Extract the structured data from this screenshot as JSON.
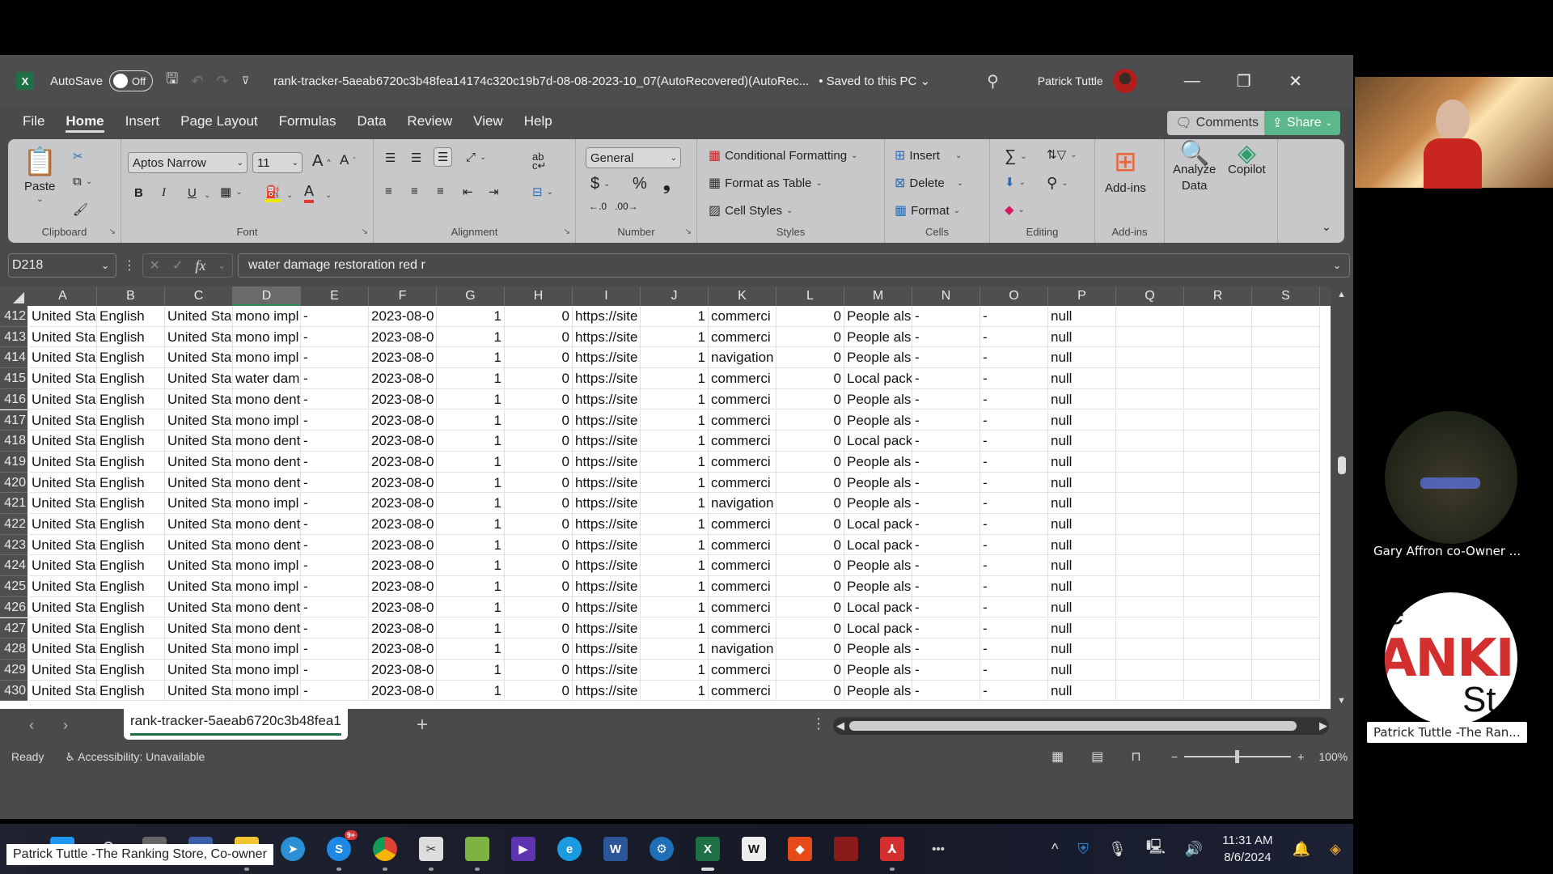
{
  "titlebar": {
    "app_icon": "excel-icon",
    "autosave_label": "AutoSave",
    "autosave_state": "Off",
    "doc_title": "rank-tracker-5aeab6720c3b48fea14174c320c19b7d-08-08-2023-10_07(AutoRecovered)(AutoRec...",
    "save_status": "• Saved to this PC",
    "user_name": "Patrick Tuttle"
  },
  "menu": {
    "tabs": [
      "File",
      "Home",
      "Insert",
      "Page Layout",
      "Formulas",
      "Data",
      "Review",
      "View",
      "Help"
    ],
    "active": "Home",
    "comments_label": "Comments",
    "share_label": "Share"
  },
  "ribbon": {
    "clipboard": {
      "paste_label": "Paste",
      "group_label": "Clipboard"
    },
    "font": {
      "font_name": "Aptos Narrow",
      "font_size": "11",
      "group_label": "Font",
      "bold": "B",
      "italic": "I",
      "underline": "U",
      "grow": "A^",
      "shrink": "Aˇ",
      "font_color_letter": "A"
    },
    "alignment": {
      "group_label": "Alignment"
    },
    "number": {
      "format": "General",
      "currency": "$",
      "percent": "%",
      "comma": "❟",
      "group_label": "Number"
    },
    "styles": {
      "conditional": "Conditional Formatting",
      "format_table": "Format as Table",
      "cell_styles": "Cell Styles",
      "group_label": "Styles"
    },
    "cells": {
      "insert": "Insert",
      "delete": "Delete",
      "format": "Format",
      "group_label": "Cells"
    },
    "editing": {
      "group_label": "Editing"
    },
    "addins": {
      "addins_label": "Add-ins",
      "group_label": "Add-ins",
      "analyze_line1": "Analyze",
      "analyze_line2": "Data",
      "copilot_label": "Copilot"
    }
  },
  "formula_bar": {
    "name_box": "D218",
    "formula": "water damage restoration red r"
  },
  "sheet": {
    "columns": [
      "A",
      "B",
      "C",
      "D",
      "E",
      "F",
      "G",
      "H",
      "I",
      "J",
      "K",
      "L",
      "M",
      "N",
      "O",
      "P",
      "Q",
      "R",
      "S"
    ],
    "selected_column": "D",
    "rows": [
      {
        "n": "412",
        "A": "United Sta",
        "B": "English",
        "C": "United Sta",
        "D": "mono impl",
        "E": "-",
        "F": "2023-08-0",
        "G": "1",
        "H": "0",
        "I": "https://site",
        "J": "1",
        "K": "commerci",
        "L": "0",
        "M": "People als",
        "N": "-",
        "O": "-",
        "P": "null"
      },
      {
        "n": "413",
        "A": "United Sta",
        "B": "English",
        "C": "United Sta",
        "D": "mono impl",
        "E": "-",
        "F": "2023-08-0",
        "G": "1",
        "H": "0",
        "I": "https://site",
        "J": "1",
        "K": "commerci",
        "L": "0",
        "M": "People als",
        "N": "-",
        "O": "-",
        "P": "null"
      },
      {
        "n": "414",
        "A": "United Sta",
        "B": "English",
        "C": "United Sta",
        "D": "mono impl",
        "E": "-",
        "F": "2023-08-0",
        "G": "1",
        "H": "0",
        "I": "https://site",
        "J": "1",
        "K": "navigation",
        "L": "0",
        "M": "People als",
        "N": "-",
        "O": "-",
        "P": "null"
      },
      {
        "n": "415",
        "A": "United Sta",
        "B": "English",
        "C": "United Sta",
        "D": "water dam",
        "E": "-",
        "F": "2023-08-0",
        "G": "1",
        "H": "0",
        "I": "https://site",
        "J": "1",
        "K": "commerci",
        "L": "0",
        "M": "Local pack",
        "N": "-",
        "O": "-",
        "P": "null"
      },
      {
        "n": "416",
        "A": "United Sta",
        "B": "English",
        "C": "United Sta",
        "D": "mono dent",
        "E": "-",
        "F": "2023-08-0",
        "G": "1",
        "H": "0",
        "I": "https://site",
        "J": "1",
        "K": "commerci",
        "L": "0",
        "M": "People als",
        "N": "-",
        "O": "-",
        "P": "null"
      },
      {
        "n": "417",
        "A": "United Sta",
        "B": "English",
        "C": "United Sta",
        "D": "mono impl",
        "E": "-",
        "F": "2023-08-0",
        "G": "1",
        "H": "0",
        "I": "https://site",
        "J": "1",
        "K": "commerci",
        "L": "0",
        "M": "People als",
        "N": "-",
        "O": "-",
        "P": "null"
      },
      {
        "n": "418",
        "A": "United Sta",
        "B": "English",
        "C": "United Sta",
        "D": "mono dent",
        "E": "-",
        "F": "2023-08-0",
        "G": "1",
        "H": "0",
        "I": "https://site",
        "J": "1",
        "K": "commerci",
        "L": "0",
        "M": "Local pack",
        "N": "-",
        "O": "-",
        "P": "null"
      },
      {
        "n": "419",
        "A": "United Sta",
        "B": "English",
        "C": "United Sta",
        "D": "mono dent",
        "E": "-",
        "F": "2023-08-0",
        "G": "1",
        "H": "0",
        "I": "https://site",
        "J": "1",
        "K": "commerci",
        "L": "0",
        "M": "People als",
        "N": "-",
        "O": "-",
        "P": "null"
      },
      {
        "n": "420",
        "A": "United Sta",
        "B": "English",
        "C": "United Sta",
        "D": "mono dent",
        "E": "-",
        "F": "2023-08-0",
        "G": "1",
        "H": "0",
        "I": "https://site",
        "J": "1",
        "K": "commerci",
        "L": "0",
        "M": "People als",
        "N": "-",
        "O": "-",
        "P": "null"
      },
      {
        "n": "421",
        "A": "United Sta",
        "B": "English",
        "C": "United Sta",
        "D": "mono impl",
        "E": "-",
        "F": "2023-08-0",
        "G": "1",
        "H": "0",
        "I": "https://site",
        "J": "1",
        "K": "navigation",
        "L": "0",
        "M": "People als",
        "N": "-",
        "O": "-",
        "P": "null"
      },
      {
        "n": "422",
        "A": "United Sta",
        "B": "English",
        "C": "United Sta",
        "D": "mono dent",
        "E": "-",
        "F": "2023-08-0",
        "G": "1",
        "H": "0",
        "I": "https://site",
        "J": "1",
        "K": "commerci",
        "L": "0",
        "M": "Local pack",
        "N": "-",
        "O": "-",
        "P": "null"
      },
      {
        "n": "423",
        "A": "United Sta",
        "B": "English",
        "C": "United Sta",
        "D": "mono dent",
        "E": "-",
        "F": "2023-08-0",
        "G": "1",
        "H": "0",
        "I": "https://site",
        "J": "1",
        "K": "commerci",
        "L": "0",
        "M": "Local pack",
        "N": "-",
        "O": "-",
        "P": "null"
      },
      {
        "n": "424",
        "A": "United Sta",
        "B": "English",
        "C": "United Sta",
        "D": "mono impl",
        "E": "-",
        "F": "2023-08-0",
        "G": "1",
        "H": "0",
        "I": "https://site",
        "J": "1",
        "K": "commerci",
        "L": "0",
        "M": "People als",
        "N": "-",
        "O": "-",
        "P": "null"
      },
      {
        "n": "425",
        "A": "United Sta",
        "B": "English",
        "C": "United Sta",
        "D": "mono impl",
        "E": "-",
        "F": "2023-08-0",
        "G": "1",
        "H": "0",
        "I": "https://site",
        "J": "1",
        "K": "commerci",
        "L": "0",
        "M": "People als",
        "N": "-",
        "O": "-",
        "P": "null"
      },
      {
        "n": "426",
        "A": "United Sta",
        "B": "English",
        "C": "United Sta",
        "D": "mono dent",
        "E": "-",
        "F": "2023-08-0",
        "G": "1",
        "H": "0",
        "I": "https://site",
        "J": "1",
        "K": "commerci",
        "L": "0",
        "M": "Local pack",
        "N": "-",
        "O": "-",
        "P": "null"
      },
      {
        "n": "427",
        "A": "United Sta",
        "B": "English",
        "C": "United Sta",
        "D": "mono dent",
        "E": "-",
        "F": "2023-08-0",
        "G": "1",
        "H": "0",
        "I": "https://site",
        "J": "1",
        "K": "commerci",
        "L": "0",
        "M": "Local pack",
        "N": "-",
        "O": "-",
        "P": "null"
      },
      {
        "n": "428",
        "A": "United Sta",
        "B": "English",
        "C": "United Sta",
        "D": "mono impl",
        "E": "-",
        "F": "2023-08-0",
        "G": "1",
        "H": "0",
        "I": "https://site",
        "J": "1",
        "K": "navigation",
        "L": "0",
        "M": "People als",
        "N": "-",
        "O": "-",
        "P": "null"
      },
      {
        "n": "429",
        "A": "United Sta",
        "B": "English",
        "C": "United Sta",
        "D": "mono impl",
        "E": "-",
        "F": "2023-08-0",
        "G": "1",
        "H": "0",
        "I": "https://site",
        "J": "1",
        "K": "commerci",
        "L": "0",
        "M": "People als",
        "N": "-",
        "O": "-",
        "P": "null"
      },
      {
        "n": "430",
        "A": "United Sta",
        "B": "English",
        "C": "United Sta",
        "D": "mono impl",
        "E": "-",
        "F": "2023-08-0",
        "G": "1",
        "H": "0",
        "I": "https://site",
        "J": "1",
        "K": "commerci",
        "L": "0",
        "M": "People als",
        "N": "-",
        "O": "-",
        "P": "null"
      }
    ],
    "numeric_columns": [
      "G",
      "H",
      "J",
      "L"
    ],
    "tab_name": "rank-tracker-5aeab6720c3b48fea1"
  },
  "statusbar": {
    "ready": "Ready",
    "accessibility": "Accessibility: Unavailable",
    "zoom": "100%",
    "zoom_fraction": 0.5
  },
  "taskbar": {
    "apps": [
      "start",
      "search",
      "task-view",
      "remote-desktop",
      "file-explorer",
      "telegram",
      "skype",
      "chrome",
      "snipping-tool",
      "notepad",
      "clipchamp",
      "edge",
      "word",
      "app-tool",
      "excel",
      "wordpad",
      "anydesk",
      "app-red",
      "acrobat",
      "more"
    ],
    "skype_badge": "9+",
    "time": "11:31 AM",
    "date": "8/6/2024"
  },
  "meeting": {
    "participant_1": "Gary Affron co-Owner ...",
    "participant_2": "Patrick Tuttle -The Ran...",
    "logo_text": "ANKIN",
    "caption": "Patrick Tuttle -The Ranking Store, Co-owner"
  },
  "colors": {
    "excel_green": "#1e7145",
    "share_green": "#5cb88a",
    "ribbon_bg": "#c8c8cb",
    "chrome_dark": "#4a4a4d"
  }
}
